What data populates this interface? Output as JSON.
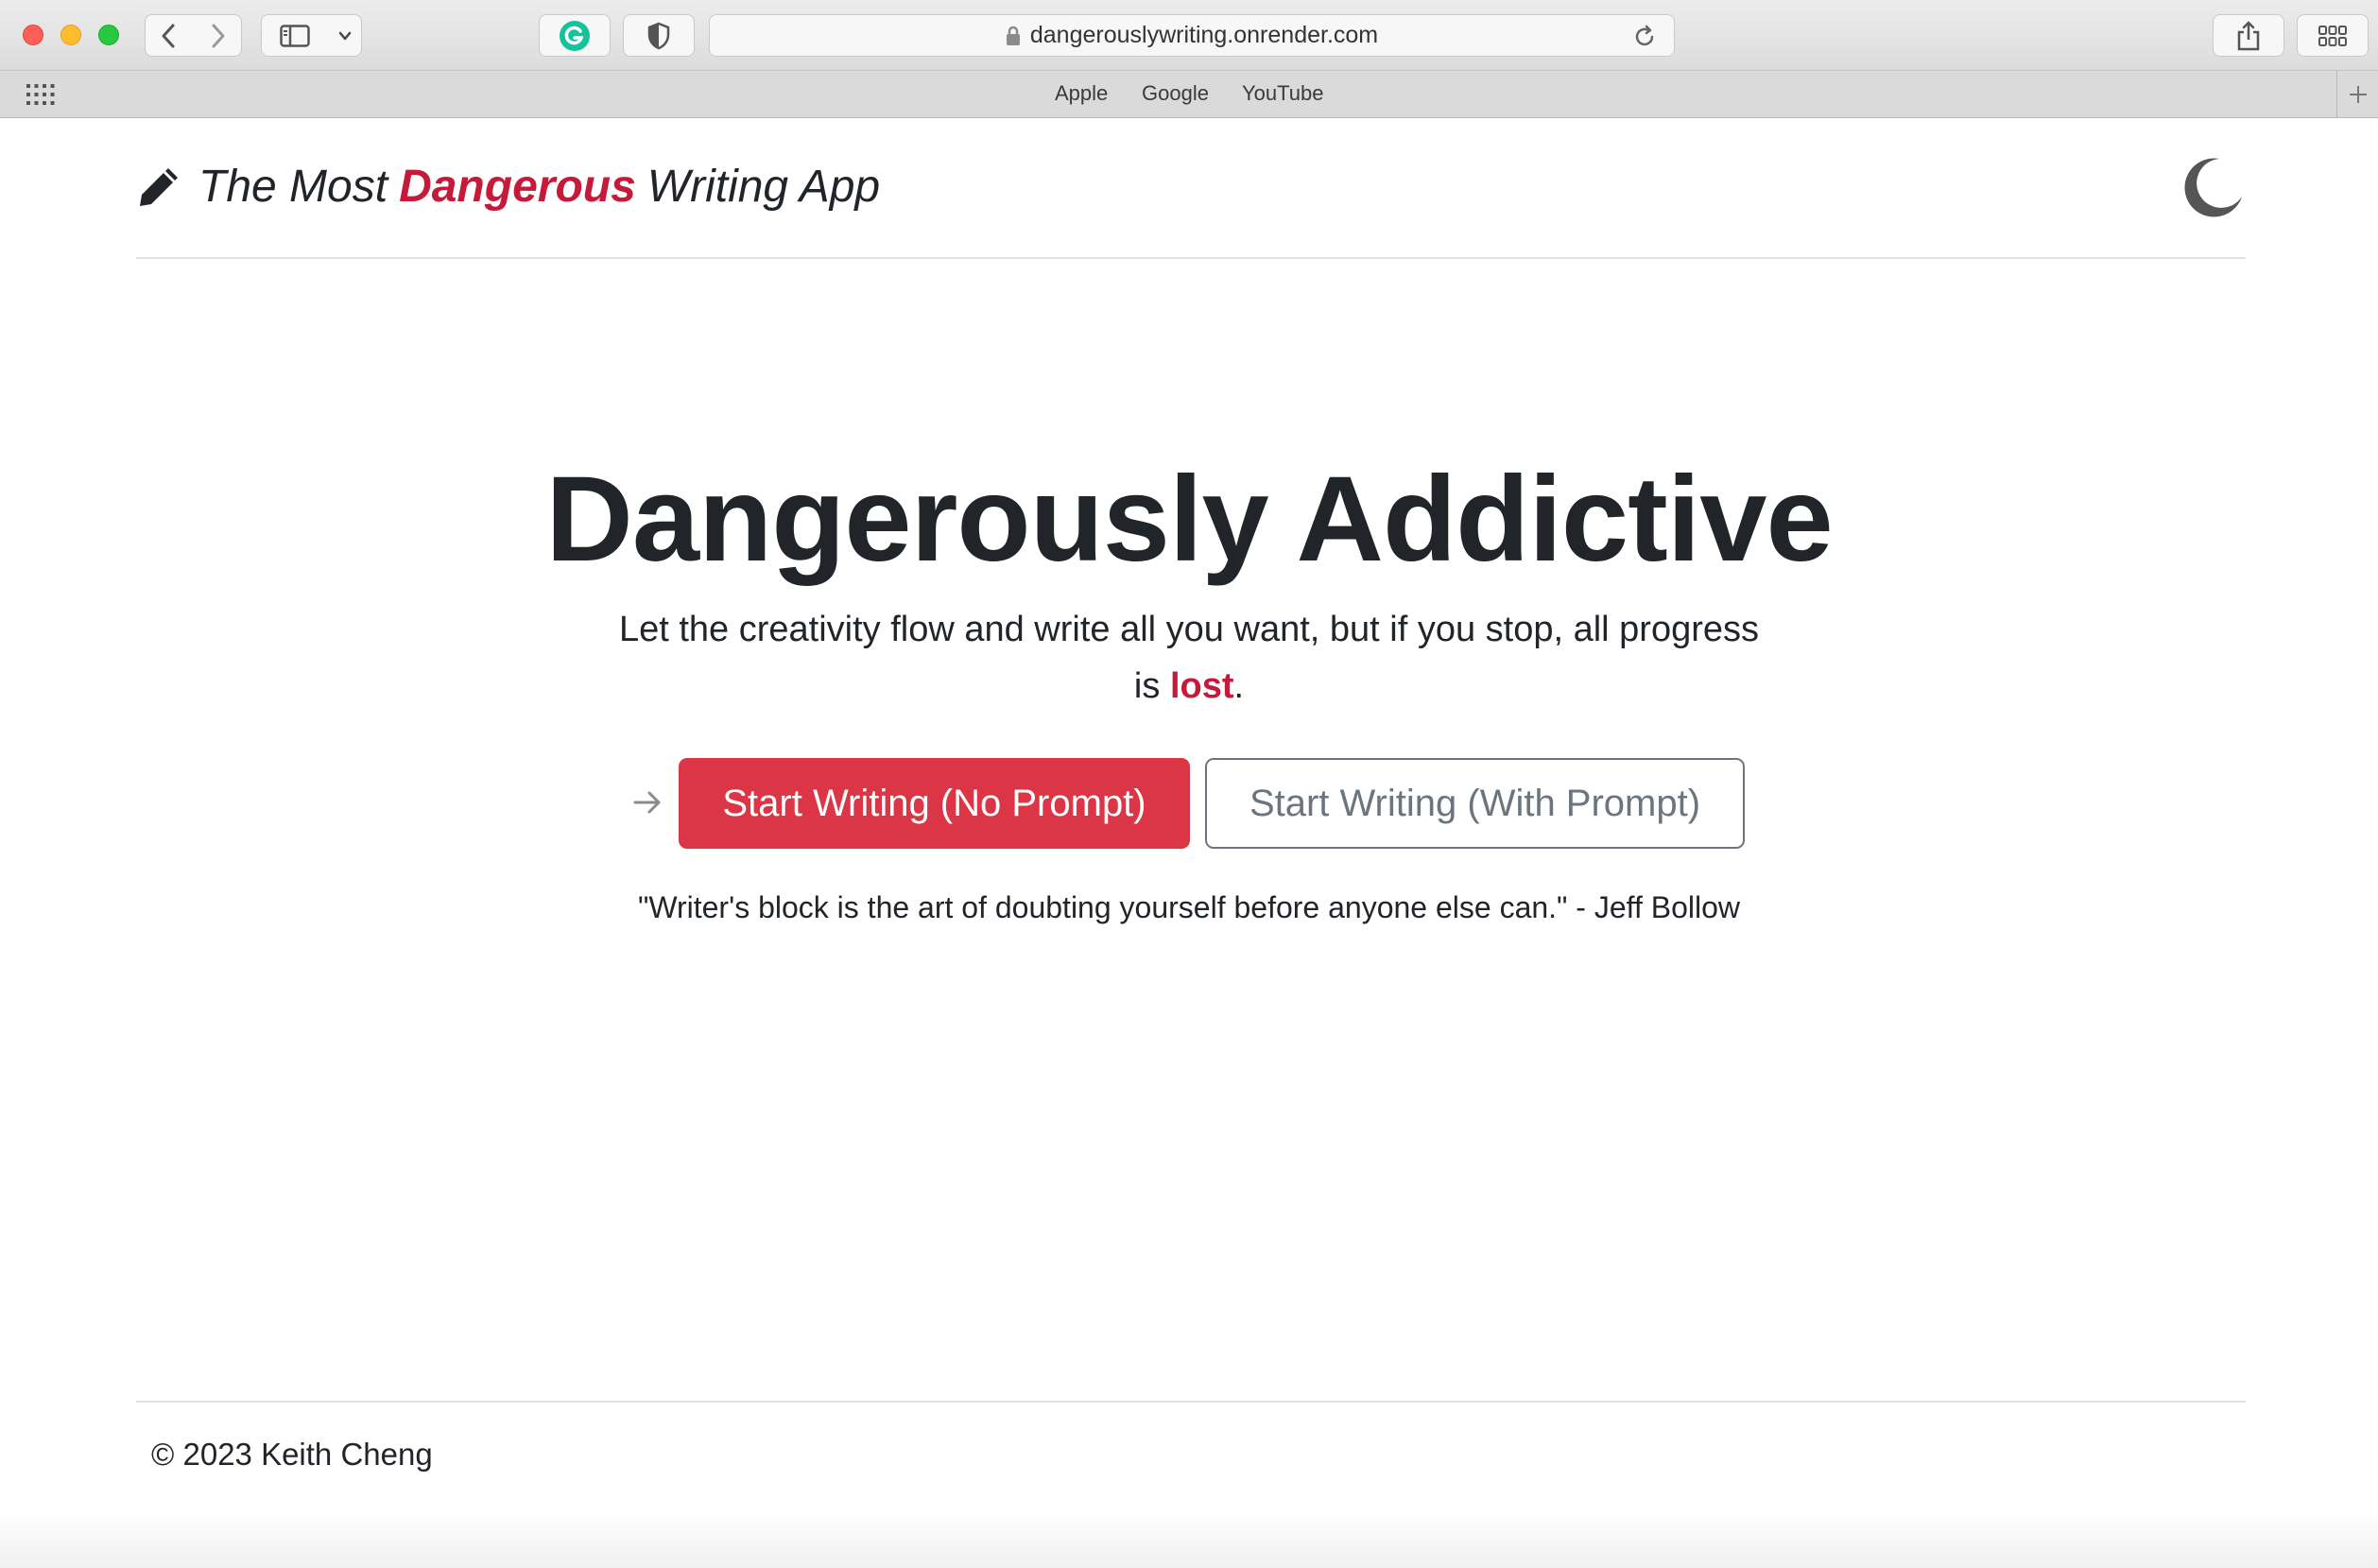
{
  "browser": {
    "url": "dangerouslywriting.onrender.com",
    "bookmarks": [
      "Apple",
      "Google",
      "YouTube"
    ],
    "icons": {
      "back": "chevron-left-icon",
      "forward": "chevron-right-icon",
      "sidebar": "sidebar-icon",
      "grammarly": "grammarly-icon",
      "shield": "shield-icon",
      "lock": "lock-icon",
      "reload": "reload-icon",
      "share": "share-icon",
      "tabs": "tab-overview-icon",
      "apps": "apps-grid-icon",
      "new_tab": "plus-icon"
    }
  },
  "header": {
    "brand_prefix": "The Most",
    "brand_highlight": "Dangerous",
    "brand_suffix": "Writing App",
    "theme_toggle_icon": "moon-icon"
  },
  "hero": {
    "title": "Dangerously Addictive",
    "subtitle_main": "Let the creativity flow and write all you want, but if you stop, all progress is",
    "subtitle_emphasis": "lost",
    "subtitle_end": "."
  },
  "actions": {
    "primary_label": "Start Writing (No Prompt)",
    "secondary_label": "Start Writing (With Prompt)"
  },
  "quote": "\"Writer's block is the art of doubting yourself before anyone else can.\" - Jeff Bollow",
  "footer": {
    "copyright": "© 2023 Keith Cheng"
  },
  "colors": {
    "brand_red": "#c61a3b",
    "button_red": "#dc3545",
    "outline_gray": "#6c757d",
    "text_dark": "#212529"
  }
}
